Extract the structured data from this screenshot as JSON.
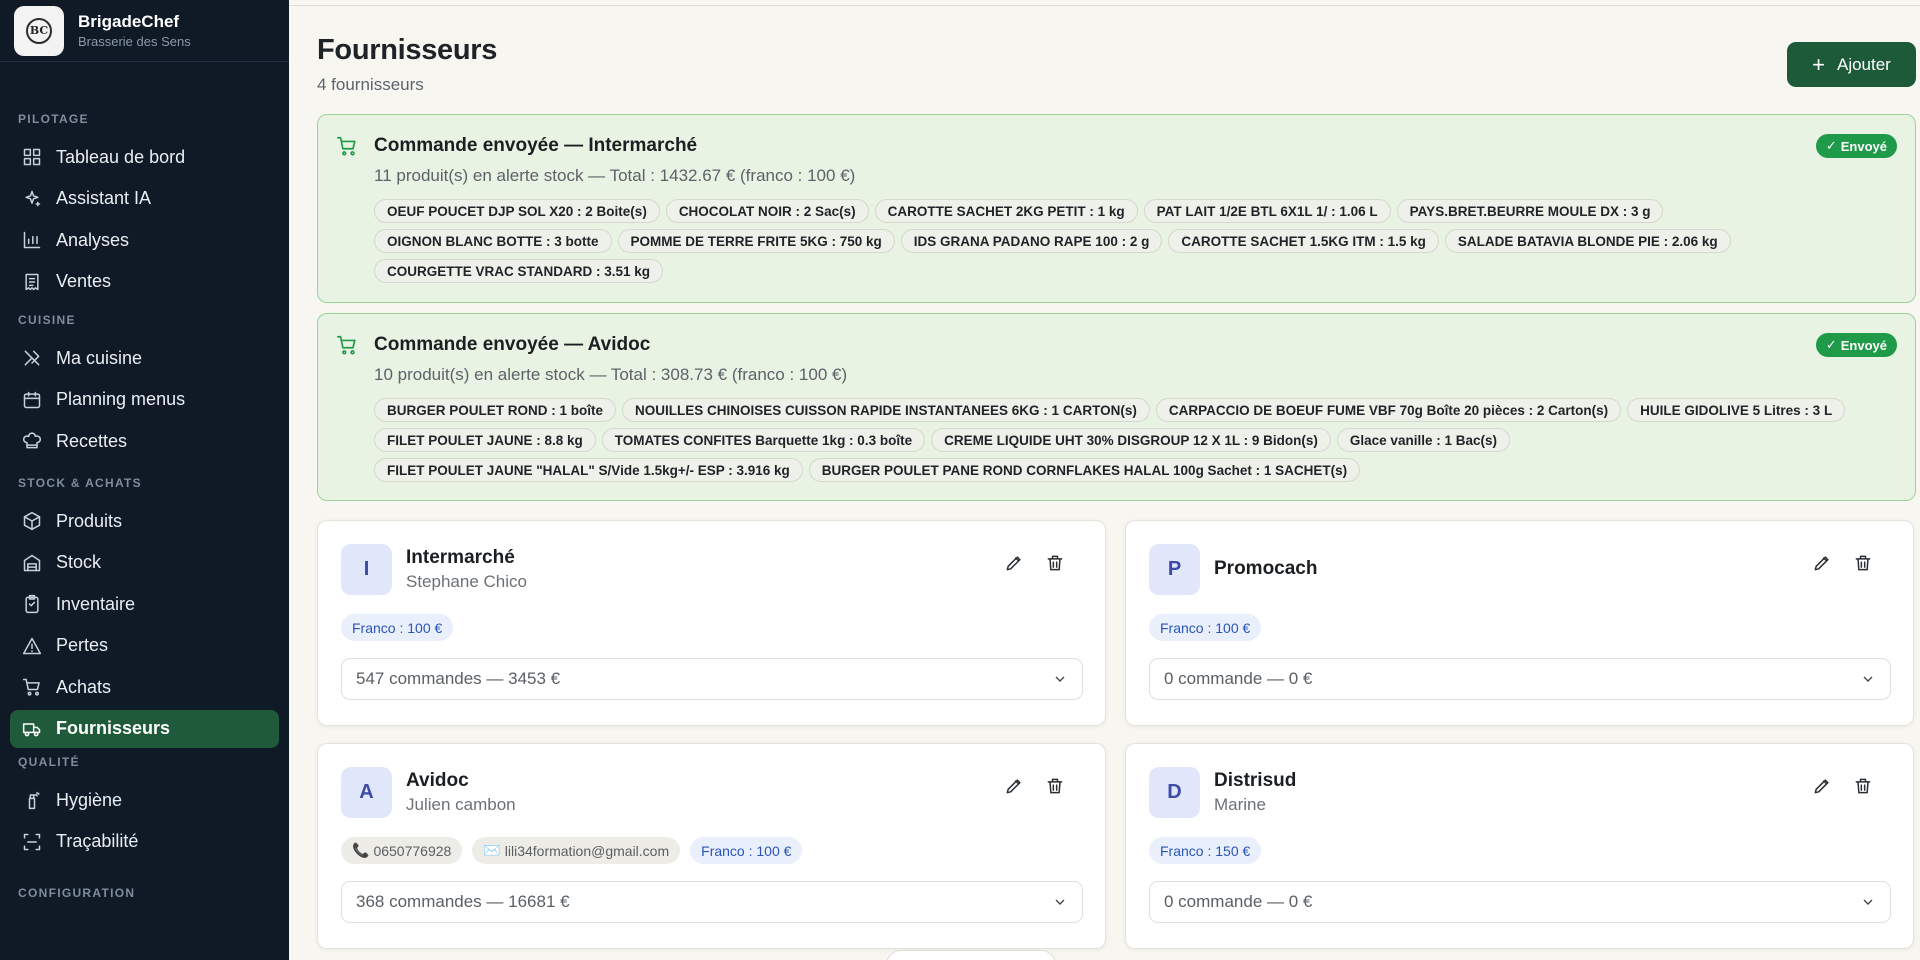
{
  "brand": {
    "name": "BrigadeChef",
    "subtitle": "Brasserie des Sens",
    "logo_text": "BC"
  },
  "sidebar": {
    "sections": [
      {
        "label": "PILOTAGE",
        "items": [
          {
            "label": "Tableau de bord",
            "icon": "dashboard-icon"
          },
          {
            "label": "Assistant IA",
            "icon": "sparkles-icon"
          },
          {
            "label": "Analyses",
            "icon": "bar-chart-icon"
          },
          {
            "label": "Ventes",
            "icon": "receipt-icon"
          }
        ]
      },
      {
        "label": "CUISINE",
        "items": [
          {
            "label": "Ma cuisine",
            "icon": "utensils-icon"
          },
          {
            "label": "Planning menus",
            "icon": "calendar-icon"
          },
          {
            "label": "Recettes",
            "icon": "chef-hat-icon"
          }
        ]
      },
      {
        "label": "STOCK & ACHATS",
        "items": [
          {
            "label": "Produits",
            "icon": "package-icon"
          },
          {
            "label": "Stock",
            "icon": "warehouse-icon"
          },
          {
            "label": "Inventaire",
            "icon": "clipboard-icon"
          },
          {
            "label": "Pertes",
            "icon": "alert-triangle-icon"
          },
          {
            "label": "Achats",
            "icon": "cart-icon"
          },
          {
            "label": "Fournisseurs",
            "icon": "truck-icon",
            "active": true
          }
        ]
      },
      {
        "label": "QUALITÉ",
        "items": [
          {
            "label": "Hygiène",
            "icon": "spray-bottle-icon"
          },
          {
            "label": "Traçabilité",
            "icon": "scan-icon"
          }
        ]
      },
      {
        "label": "CONFIGURATION",
        "items": []
      }
    ]
  },
  "page": {
    "title": "Fournisseurs",
    "subtitle": "4 fournisseurs",
    "add_label": "Ajouter"
  },
  "orders": [
    {
      "title": "Commande envoyée — Intermarché",
      "meta": "11 produit(s) en alerte stock — Total : 1432.67 € (franco : 100 €)",
      "status": "Envoyé",
      "items": [
        "OEUF POUCET DJP SOL X20 : 2 Boite(s)",
        "CHOCOLAT NOIR : 2 Sac(s)",
        "CAROTTE SACHET 2KG PETIT : 1 kg",
        "PAT LAIT 1/2E BTL 6X1L 1/ : 1.06 L",
        "PAYS.BRET.BEURRE MOULE DX : 3 g",
        "OIGNON BLANC BOTTE : 3 botte",
        "POMME DE TERRE FRITE 5KG : 750 kg",
        "IDS GRANA PADANO RAPE 100 : 2 g",
        "CAROTTE SACHET 1.5KG ITM : 1.5 kg",
        "SALADE BATAVIA BLONDE PIE : 2.06 kg",
        "COURGETTE VRAC STANDARD : 3.51 kg"
      ]
    },
    {
      "title": "Commande envoyée — Avidoc",
      "meta": "10 produit(s) en alerte stock — Total : 308.73 € (franco : 100 €)",
      "status": "Envoyé",
      "items": [
        "BURGER POULET ROND : 1 boîte",
        "NOUILLES CHINOISES CUISSON RAPIDE INSTANTANEES 6KG : 1 CARTON(s)",
        "CARPACCIO DE BOEUF FUME VBF 70g Boîte 20 pièces : 2 Carton(s)",
        "HUILE GIDOLIVE 5 Litres : 3 L",
        "FILET POULET JAUNE : 8.8 kg",
        "TOMATES CONFITES Barquette 1kg : 0.3 boîte",
        "CREME LIQUIDE UHT 30% DISGROUP 12 X 1L : 9 Bidon(s)",
        "Glace vanille : 1 Bac(s)",
        "FILET POULET JAUNE \"HALAL\" S/Vide 1.5kg+/- ESP : 3.916 kg",
        "BURGER POULET PANE ROND CORNFLAKES HALAL 100g Sachet : 1 SACHET(s)"
      ]
    }
  ],
  "suppliers": [
    {
      "initial": "I",
      "name": "Intermarché",
      "contact": "Stephane Chico",
      "phone": "",
      "email": "",
      "franco": "Franco : 100 €",
      "orders": "547 commandes — 3453 €"
    },
    {
      "initial": "P",
      "name": "Promocach",
      "contact": "",
      "phone": "",
      "email": "",
      "franco": "Franco : 100 €",
      "orders": "0 commande — 0 €"
    },
    {
      "initial": "A",
      "name": "Avidoc",
      "contact": "Julien cambon",
      "phone": "0650776928",
      "email": "lili34formation@gmail.com",
      "franco": "Franco : 100 €",
      "orders": "368 commandes — 16681 €"
    },
    {
      "initial": "D",
      "name": "Distrisud",
      "contact": "Marine",
      "phone": "",
      "email": "",
      "franco": "Franco : 150 €",
      "orders": "0 commande — 0 €"
    }
  ],
  "colors": {
    "sidebar_bg": "#0f1a26",
    "active_bg": "#1f5a3a",
    "accent": "#1d5a3a",
    "success": "#1f9a49",
    "order_bg": "#e8f3e3"
  }
}
